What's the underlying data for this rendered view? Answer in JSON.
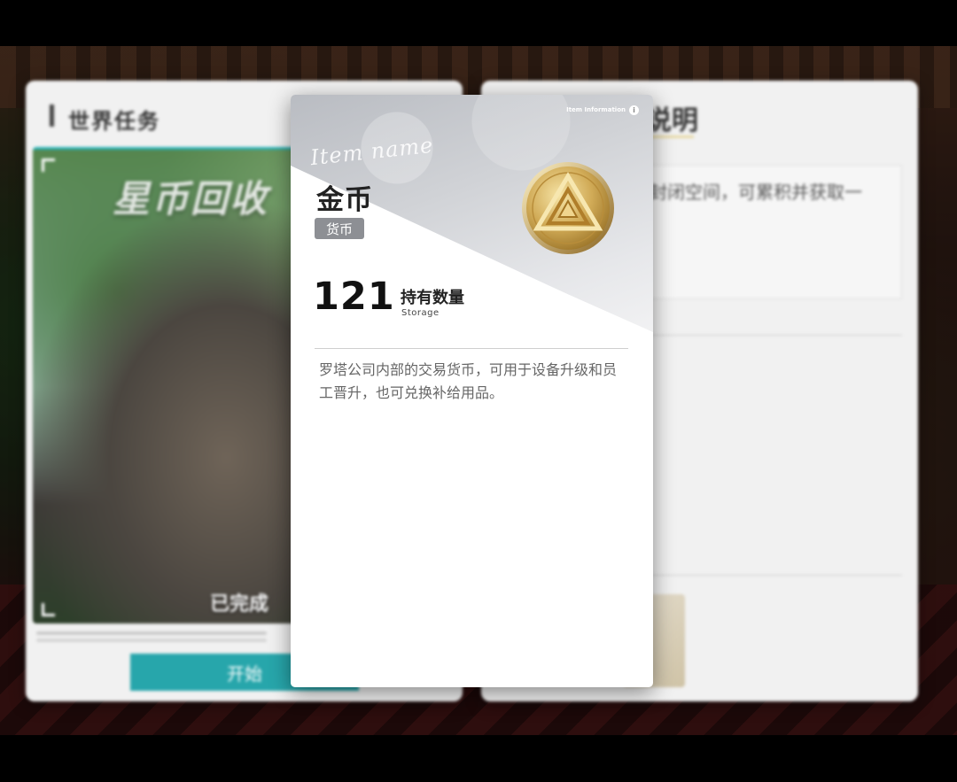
{
  "world_task_panel": {
    "title": "世界任务",
    "banner": "星币回收",
    "status": "已完成",
    "start_button": "开始"
  },
  "detail_panel": {
    "title": "说明",
    "description_fragment": "封闭空间，可累积并获取一"
  },
  "item_popup": {
    "info_tag": "Item Information",
    "info_icon": "i",
    "script_caption": "Item name",
    "name": "金币",
    "category": "货币",
    "quantity": "121",
    "quantity_label": "持有数量",
    "quantity_sublabel": "Storage",
    "description": "罗塔公司内部的交易货币，可用于设备升级和员工晋升，也可兑换补给用品。",
    "icon": "gold-coin-icon",
    "accent_color": "#c9a24a"
  }
}
